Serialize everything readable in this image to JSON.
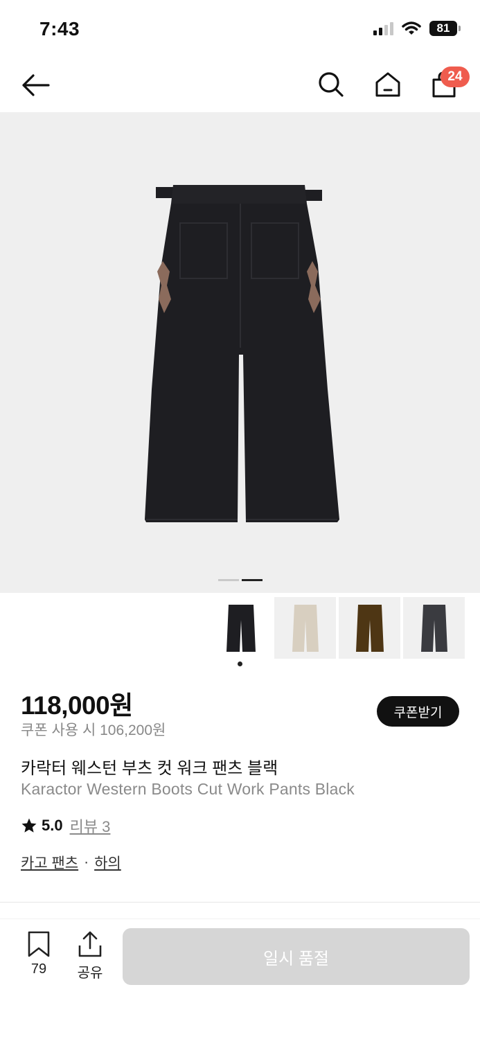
{
  "status_bar": {
    "time": "7:43",
    "battery": "81",
    "icons": [
      "cellular-signal-icon",
      "wifi-icon",
      "battery-icon"
    ]
  },
  "nav": {
    "icons": [
      "back-arrow-icon",
      "search-icon",
      "home-icon",
      "shopping-bag-icon"
    ],
    "cart_count": "24"
  },
  "hero": {
    "image": "black-pants-back-view",
    "slide_count": 2,
    "active_slide": 2
  },
  "thumbnails": [
    {
      "color": "black",
      "hex": "#1e1e22",
      "selected": true
    },
    {
      "color": "cream",
      "hex": "#d8cfc0",
      "selected": false
    },
    {
      "color": "brown",
      "hex": "#4e3614",
      "selected": false
    },
    {
      "color": "charcoal",
      "hex": "#3a3b40",
      "selected": false
    }
  ],
  "product": {
    "price": "118,000원",
    "coupon_price": "쿠폰 사용 시 106,200원",
    "coupon_button": "쿠폰받기",
    "title_ko": "카락터 웨스턴 부츠 컷 워크 팬츠 블랙",
    "title_en": "Karactor Western Boots Cut Work Pants Black",
    "rating": "5.0",
    "review_label": "리뷰 3",
    "category_1": "카고 팬츠",
    "separator": "·",
    "category_2": "하의"
  },
  "bottom_bar": {
    "bookmark_count": "79",
    "share_label": "공유",
    "soldout_label": "일시 품절"
  },
  "colors": {
    "accent_badge": "#ef5c4e",
    "disabled_button": "#d6d6d6",
    "hero_bg": "#efefef"
  }
}
